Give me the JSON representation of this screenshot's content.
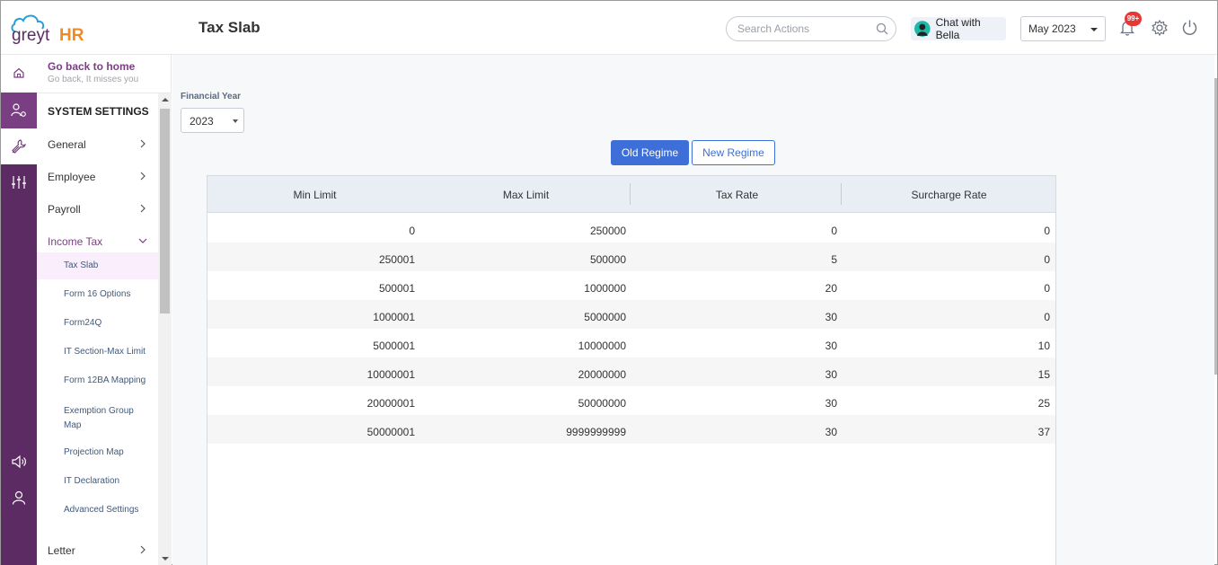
{
  "brand": {
    "name_prefix": "greyt",
    "name_suffix": "HR",
    "primary_color": "#5c2b63",
    "accent_color": "#f08a24"
  },
  "header": {
    "title": "Tax Slab",
    "search_placeholder": "Search Actions",
    "chat_label": "Chat with Bella",
    "month_selected": "May 2023",
    "notification_count": "99+"
  },
  "sidebar": {
    "go_back_title": "Go back to home",
    "go_back_subtitle": "Go back, It misses you",
    "section_title": "SYSTEM SETTINGS",
    "items": [
      {
        "label": "General"
      },
      {
        "label": "Employee"
      },
      {
        "label": "Payroll"
      },
      {
        "label": "Income Tax"
      },
      {
        "label": "Letter"
      }
    ],
    "income_tax_subitems": [
      {
        "label": "Tax Slab"
      },
      {
        "label": "Form 16 Options"
      },
      {
        "label": "Form24Q"
      },
      {
        "label": "IT Section-Max Limit"
      },
      {
        "label": "Form 12BA Mapping"
      },
      {
        "label": "Exemption Group Map"
      },
      {
        "label": "Projection Map"
      },
      {
        "label": "IT Declaration"
      },
      {
        "label": "Advanced Settings"
      }
    ]
  },
  "filters": {
    "financial_year_label": "Financial Year",
    "financial_year_value": "2023"
  },
  "regime": {
    "old_label": "Old Regime",
    "new_label": "New Regime",
    "active": "old"
  },
  "table": {
    "headers": [
      "Min Limit",
      "Max Limit",
      "Tax Rate",
      "Surcharge Rate"
    ],
    "rows": [
      [
        "0",
        "250000",
        "0",
        "0"
      ],
      [
        "250001",
        "500000",
        "5",
        "0"
      ],
      [
        "500001",
        "1000000",
        "20",
        "0"
      ],
      [
        "1000001",
        "5000000",
        "30",
        "0"
      ],
      [
        "5000001",
        "10000000",
        "30",
        "10"
      ],
      [
        "10000001",
        "20000000",
        "30",
        "15"
      ],
      [
        "20000001",
        "50000000",
        "30",
        "25"
      ],
      [
        "50000001",
        "9999999999",
        "30",
        "37"
      ]
    ]
  }
}
